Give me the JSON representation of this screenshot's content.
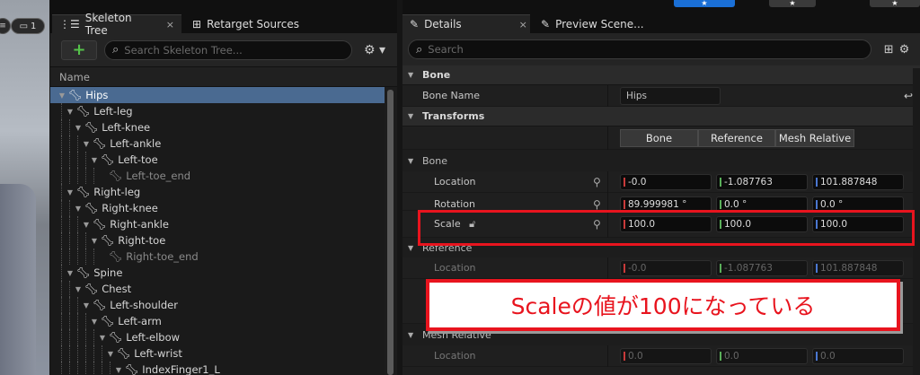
{
  "viewport": {
    "camera_label": "1"
  },
  "skeleton": {
    "tabs": [
      {
        "label": "Skeleton Tree",
        "close": "×"
      },
      {
        "label": "Retarget Sources"
      }
    ],
    "add_label": "+",
    "search_placeholder": "Search Skeleton Tree...",
    "column_header": "Name",
    "rows": [
      {
        "label": "Hips",
        "depth": 0,
        "selected": true
      },
      {
        "label": "Left-leg",
        "depth": 1
      },
      {
        "label": "Left-knee",
        "depth": 2
      },
      {
        "label": "Left-ankle",
        "depth": 3
      },
      {
        "label": "Left-toe",
        "depth": 4
      },
      {
        "label": "Left-toe_end",
        "depth": 5,
        "leaf": true
      },
      {
        "label": "Right-leg",
        "depth": 1
      },
      {
        "label": "Right-knee",
        "depth": 2
      },
      {
        "label": "Right-ankle",
        "depth": 3
      },
      {
        "label": "Right-toe",
        "depth": 4
      },
      {
        "label": "Right-toe_end",
        "depth": 5,
        "leaf": true
      },
      {
        "label": "Spine",
        "depth": 1
      },
      {
        "label": "Chest",
        "depth": 2
      },
      {
        "label": "Left-shoulder",
        "depth": 3
      },
      {
        "label": "Left-arm",
        "depth": 4
      },
      {
        "label": "Left-elbow",
        "depth": 5
      },
      {
        "label": "Left-wrist",
        "depth": 6
      },
      {
        "label": "IndexFinger1_L",
        "depth": 7
      }
    ]
  },
  "details": {
    "tabs": [
      {
        "label": "Details",
        "close": "×"
      },
      {
        "label": "Preview Scene..."
      }
    ],
    "search_placeholder": "Search",
    "bone_category": "Bone",
    "bone_name_label": "Bone Name",
    "bone_name_value": "Hips",
    "transforms_category": "Transforms",
    "mode_buttons": [
      "Bone",
      "Reference",
      "Mesh Relative"
    ],
    "bone_sub": "Bone",
    "location_label": "Location",
    "location": [
      "-0.0",
      "-1.087763",
      "101.887848"
    ],
    "rotation_label": "Rotation",
    "rotation": [
      "89.999981 °",
      "0.0 °",
      "0.0 °"
    ],
    "scale_label": "Scale",
    "scale": [
      "100.0",
      "100.0",
      "100.0"
    ],
    "reference_sub": "Reference",
    "ref_location_label": "Location",
    "ref_location": [
      "-0.0",
      "-1.087763",
      "101.887848"
    ],
    "mesh_relative_sub": "Mesh Relative",
    "mr_location_label": "Location",
    "mr_location": [
      "0.0",
      "0.0",
      "0.0"
    ]
  },
  "annotation": {
    "text": "Scaleの値が100になっている",
    "color": "#e8141e"
  }
}
